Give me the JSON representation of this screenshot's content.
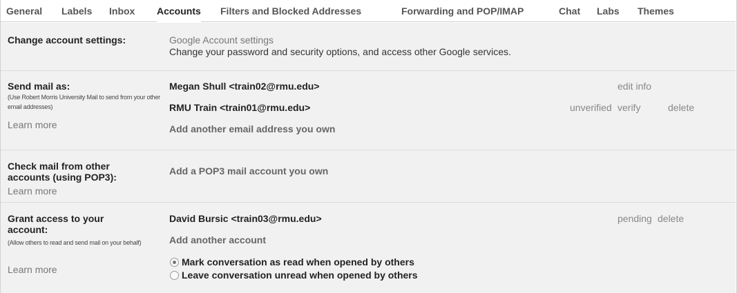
{
  "tabs": [
    {
      "label": "General"
    },
    {
      "label": "Labels"
    },
    {
      "label": "Inbox"
    },
    {
      "label": "Accounts",
      "active": true
    },
    {
      "label": "Filters and Blocked Addresses"
    },
    {
      "label": "Forwarding and POP/IMAP"
    },
    {
      "label": "Chat"
    },
    {
      "label": "Labs"
    },
    {
      "label": "Themes"
    }
  ],
  "change_account": {
    "label": "Change account settings:",
    "link": "Google Account settings",
    "desc": "Change your password and security options, and access other Google services."
  },
  "send_mail": {
    "label": "Send mail as:",
    "help": "(Use Robert Morris University Mail to send from your other email addresses)",
    "learn_more": "Learn more",
    "entries": [
      {
        "address": "Megan Shull <train02@rmu.edu>",
        "action1": "edit info"
      },
      {
        "address": "RMU Train <train01@rmu.edu>",
        "status": "unverified",
        "action1": "verify",
        "action2": "delete"
      }
    ],
    "add_link": "Add another email address you own"
  },
  "check_mail": {
    "label": "Check mail from other accounts (using POP3):",
    "learn_more": "Learn more",
    "add_link": "Add a POP3 mail account you own"
  },
  "grant_access": {
    "label": "Grant access to your account:",
    "help": "(Allow others to read and send mail on your behalf)",
    "learn_more": "Learn more",
    "entry": {
      "address": "David Bursic <train03@rmu.edu>",
      "status": "pending",
      "action": "delete"
    },
    "add_link": "Add another account",
    "options": [
      {
        "label": "Mark conversation as read when opened by others",
        "checked": true
      },
      {
        "label": "Leave conversation unread when opened by others",
        "checked": false
      }
    ]
  }
}
